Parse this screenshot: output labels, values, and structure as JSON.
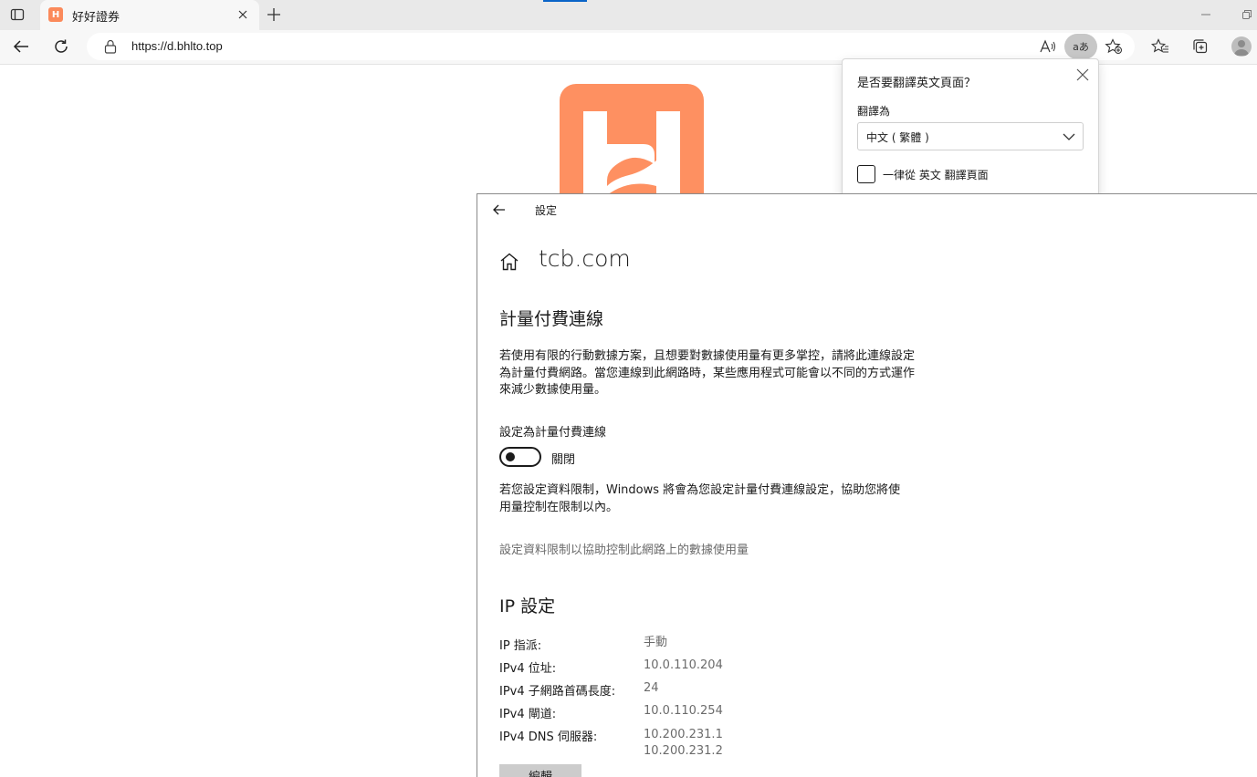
{
  "browser": {
    "tab": {
      "title": "好好證券",
      "favicon_text": "H"
    },
    "address": {
      "url": "https://d.bhlto.top"
    },
    "translate_pill_text": "aあ"
  },
  "translate_popup": {
    "title": "是否要翻譯英文頁面？",
    "label": "翻譯為",
    "selected_language": "中文 ( 繁體 )",
    "checkbox_label": "一律從 英文 翻譯頁面",
    "checkbox_checked": false
  },
  "settings": {
    "app_title": "設定",
    "page_title": "tcb.com",
    "metered": {
      "heading": "計量付費連線",
      "description": "若使用有限的行動數據方案，且想要對數據使用量有更多掌控，請將此連線設定為計量付費網路。當您連線到此網路時，某些應用程式可能會以不同的方式運作來減少數據使用量。",
      "toggle_label": "設定為計量付費連線",
      "toggle_state": "關閉",
      "toggle_on": false,
      "data_limit_note": "若您設定資料限制，Windows 將會為您設定計量付費連線設定，協助您將使用量控制在限制以內。",
      "data_limit_link": "設定資料限制以協助控制此網路上的數據使用量"
    },
    "ip": {
      "heading": "IP 設定",
      "rows": [
        {
          "label": "IP 指派:",
          "value": "手動"
        },
        {
          "label": "IPv4 位址:",
          "value": "10.0.110.204"
        },
        {
          "label": "IPv4 子網路首碼長度:",
          "value": "24"
        },
        {
          "label": "IPv4 閘道:",
          "value": "10.0.110.254"
        },
        {
          "label": "IPv4 DNS 伺服器:",
          "value": "10.200.231.1",
          "value2": "10.200.231.2"
        }
      ],
      "edit_button": "編輯"
    }
  },
  "colors": {
    "brand_orange": "#fe9061",
    "link_gray": "#6b6b6b",
    "edge_blue": "#0a64c8"
  }
}
